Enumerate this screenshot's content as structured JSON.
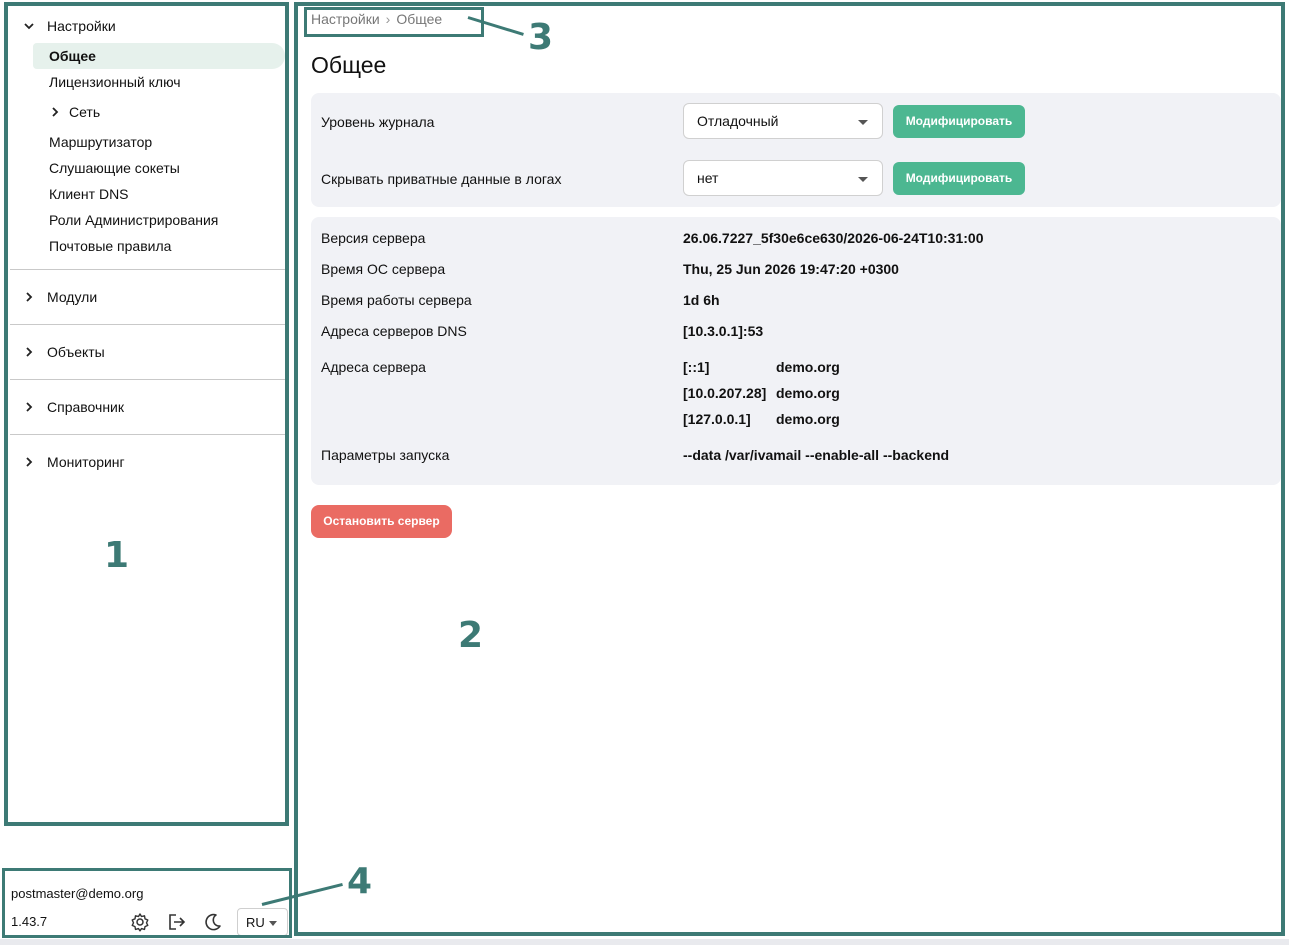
{
  "sidebar": {
    "settings_label": "Настройки",
    "settings_items": [
      "Общее",
      "Лицензионный ключ",
      "Сеть",
      "Маршрутизатор",
      "Слушающие сокеты",
      "Клиент DNS",
      "Роли Администрирования",
      "Почтовые правила"
    ],
    "groups": [
      "Модули",
      "Объекты",
      "Справочник",
      "Мониторинг"
    ],
    "icons": {
      "expanded": "chevron-down-icon",
      "collapsed": "chevron-right-icon"
    }
  },
  "footer": {
    "user": "postmaster@demo.org",
    "version": "1.43.7",
    "language": "RU",
    "icons": [
      "gear-icon",
      "logout-icon",
      "moon-icon"
    ]
  },
  "breadcrumb": {
    "root": "Настройки",
    "separator": "›",
    "current": "Общее"
  },
  "page": {
    "title": "Общее",
    "log_level": {
      "label": "Уровень журнала",
      "value": "Отладочный",
      "button": "Модифицировать"
    },
    "hide_private": {
      "label": "Скрывать приватные данные в логах",
      "value": "нет",
      "button": "Модифицировать"
    },
    "info": {
      "server_version": {
        "label": "Версия сервера",
        "value": "26.06.7227_5f30e6ce630/2026-06-24T10:31:00"
      },
      "os_time": {
        "label": "Время ОС сервера",
        "value": "Thu, 25 Jun 2026 19:47:20 +0300"
      },
      "uptime": {
        "label": "Время работы сервера",
        "value": "1d 6h"
      },
      "dns": {
        "label": "Адреса серверов DNS",
        "value": "[10.3.0.1]:53"
      },
      "addresses": {
        "label": "Адреса сервера",
        "rows": [
          {
            "ip": "[::1]",
            "domain": "demo.org"
          },
          {
            "ip": "[10.0.207.28]",
            "domain": "demo.org"
          },
          {
            "ip": "[127.0.0.1]",
            "domain": "demo.org"
          }
        ]
      },
      "launch": {
        "label": "Параметры запуска",
        "value": "--data /var/ivamail --enable-all --backend"
      }
    },
    "stop_button": "Остановить сервер"
  },
  "annotations": {
    "n1": "1",
    "n2": "2",
    "n3": "3",
    "n4": "4"
  },
  "colors": {
    "accent_green": "#4cb791",
    "danger_red": "#ea6b63",
    "frame": "#3d7a75",
    "active_bg": "#e6f1ec",
    "panel_bg": "#f1f2f6"
  }
}
